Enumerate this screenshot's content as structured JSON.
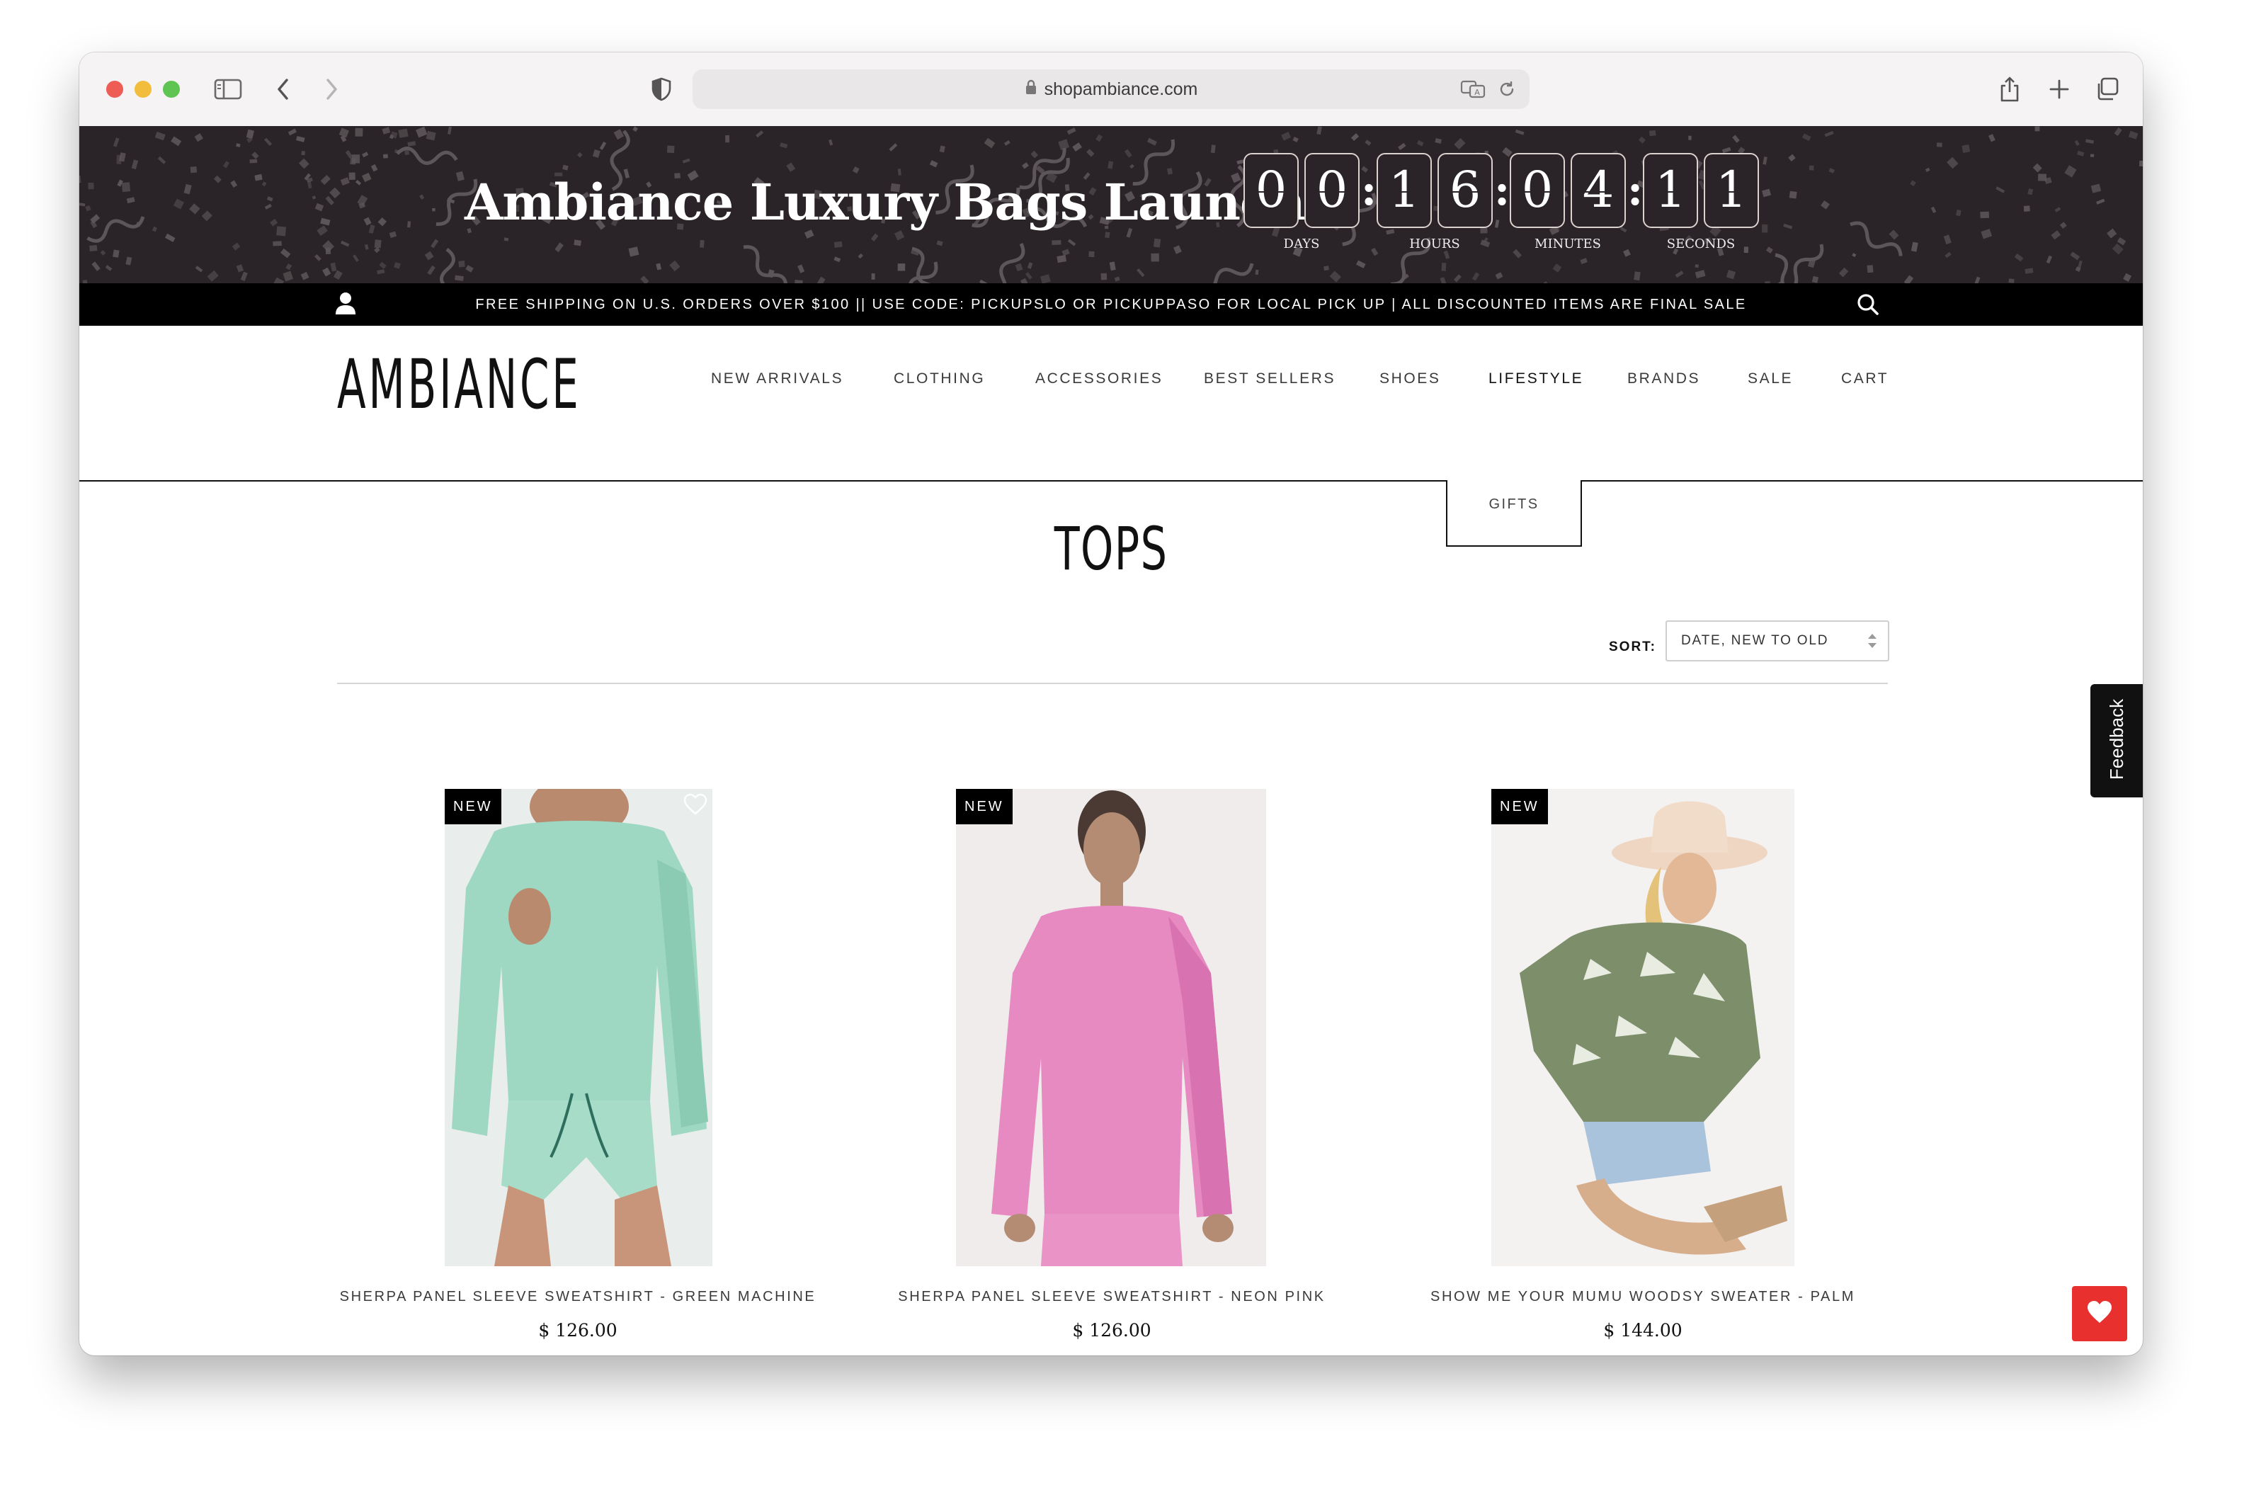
{
  "browser": {
    "url": "shopambiance.com"
  },
  "promo": {
    "title": "Ambiance Luxury Bags Launch",
    "timer": [
      {
        "label": "DAYS",
        "digits": [
          "0",
          "0"
        ]
      },
      {
        "label": "HOURS",
        "digits": [
          "1",
          "6"
        ]
      },
      {
        "label": "MINUTES",
        "digits": [
          "0",
          "4"
        ]
      },
      {
        "label": "SECONDS",
        "digits": [
          "1",
          "1"
        ]
      }
    ],
    "separator": ":"
  },
  "announcement": {
    "text": "FREE SHIPPING ON U.S. ORDERS OVER $100 || USE CODE: PICKUPSLO OR PICKUPPASO FOR LOCAL PICK UP | ALL DISCOUNTED ITEMS ARE FINAL SALE"
  },
  "header": {
    "logo": "AMBIANCE",
    "nav": [
      {
        "label": "NEW ARRIVALS"
      },
      {
        "label": "CLOTHING"
      },
      {
        "label": "ACCESSORIES"
      },
      {
        "label": "BEST SELLERS"
      },
      {
        "label": "SHOES"
      },
      {
        "label": "LIFESTYLE"
      },
      {
        "label": "BRANDS"
      },
      {
        "label": "SALE"
      },
      {
        "label": "CART"
      }
    ],
    "dropdown": {
      "items": [
        "GIFTS"
      ]
    }
  },
  "collection": {
    "title": "TOPS",
    "sort_label": "SORT:",
    "sort_value": "DATE, NEW TO OLD"
  },
  "feedback": {
    "label": "Feedback"
  },
  "products": [
    {
      "badge": "NEW",
      "name": "SHERPA PANEL SLEEVE SWEATSHIRT - GREEN MACHINE",
      "price": "$ 126.00"
    },
    {
      "badge": "NEW",
      "name": "SHERPA PANEL SLEEVE SWEATSHIRT - NEON PINK",
      "price": "$ 126.00"
    },
    {
      "badge": "NEW",
      "name": "SHOW ME YOUR MUMU WOODSY SWEATER - PALM",
      "price": "$ 144.00"
    }
  ],
  "colors": {
    "banner_bg": "#2a2428",
    "announce_bg": "#000000",
    "wishlist_accent": "#e8302f"
  },
  "icons": {
    "account": "person-icon",
    "search": "search-icon",
    "wishlist": "heart-icon"
  }
}
